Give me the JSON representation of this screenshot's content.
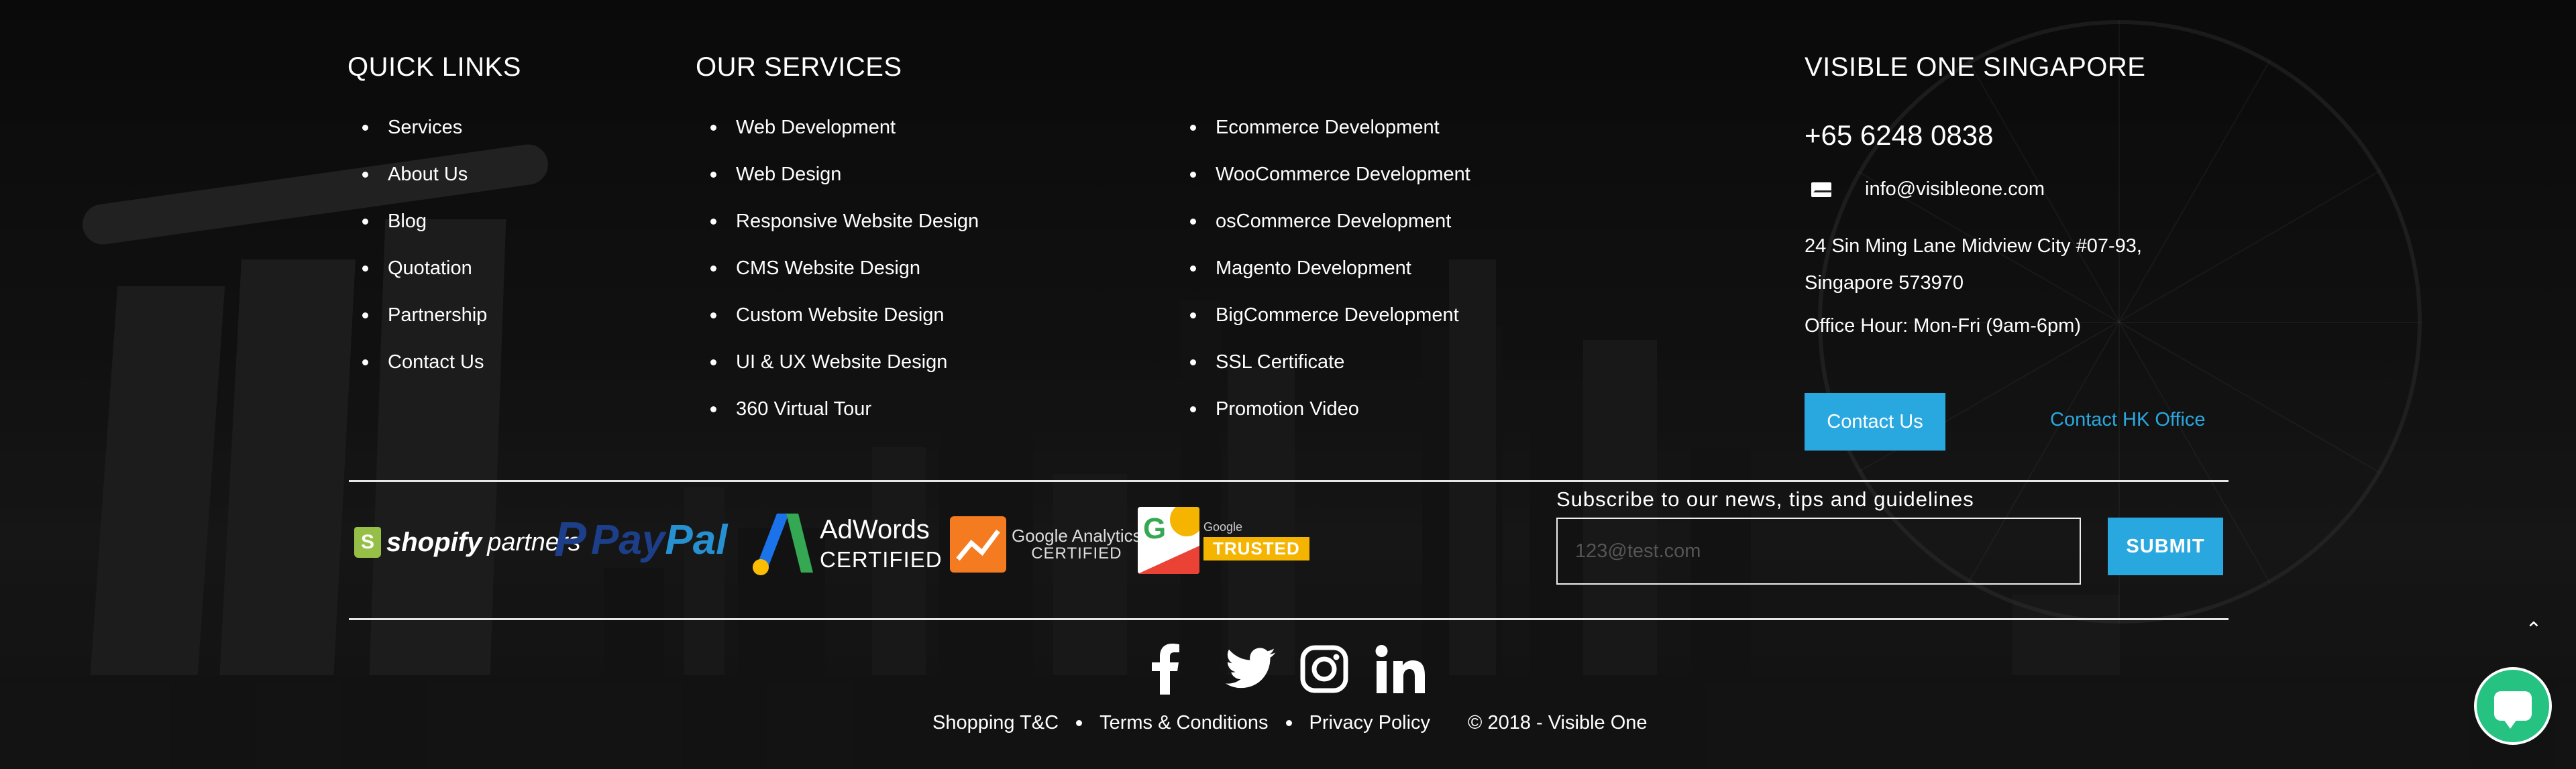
{
  "quick_links": {
    "title": "QUICK LINKS",
    "items": [
      "Services",
      "About Us",
      "Blog",
      "Quotation",
      "Partnership",
      "Contact Us"
    ]
  },
  "our_services": {
    "title": "OUR SERVICES",
    "col1": [
      "Web Development",
      "Web Design",
      "Responsive Website Design",
      "CMS Website Design",
      "Custom Website Design",
      "UI & UX Website Design",
      "360 Virtual Tour"
    ],
    "col2": [
      "Ecommerce Development",
      "WooCommerce Development",
      "osCommerce Development",
      "Magento Development",
      "BigCommerce Development",
      "SSL Certificate",
      "Promotion Video"
    ]
  },
  "contact": {
    "title": "VISIBLE ONE SINGAPORE",
    "phone": "+65 6248 0838",
    "email": "info@visibleone.com",
    "address_line1": "24 Sin Ming Lane Midview City #07-93,",
    "address_line2": "Singapore 573970",
    "office_hour": "Office Hour: Mon-Fri (9am-6pm)",
    "contact_button": "Contact Us",
    "hk_link": "Contact HK Office"
  },
  "partners": {
    "shopify_mark": "S",
    "shopify": "shopify",
    "shopify_suffix": "partners",
    "paypal_pay": "Pay",
    "paypal_pal": "Pal",
    "adwords": "AdWords",
    "adwords_sub": "CERTIFIED",
    "analytics": "Google Analytics",
    "analytics_sub": "CERTIFIED",
    "trusted_small": "Google",
    "trusted": "TRUSTED"
  },
  "subscribe": {
    "label": "Subscribe to our news, tips and guidelines",
    "placeholder": "123@test.com",
    "button": "SUBMIT"
  },
  "social": [
    "facebook-icon",
    "twitter-icon",
    "instagram-icon",
    "linkedin-icon"
  ],
  "footer": {
    "shopping": "Shopping T&C",
    "terms": "Terms & Conditions",
    "privacy": "Privacy Policy",
    "copyright": "© 2018 - Visible One"
  },
  "misc": {
    "scroll_top": "⌃"
  },
  "colors": {
    "accent": "#29a8e0",
    "chat": "#26c281"
  }
}
